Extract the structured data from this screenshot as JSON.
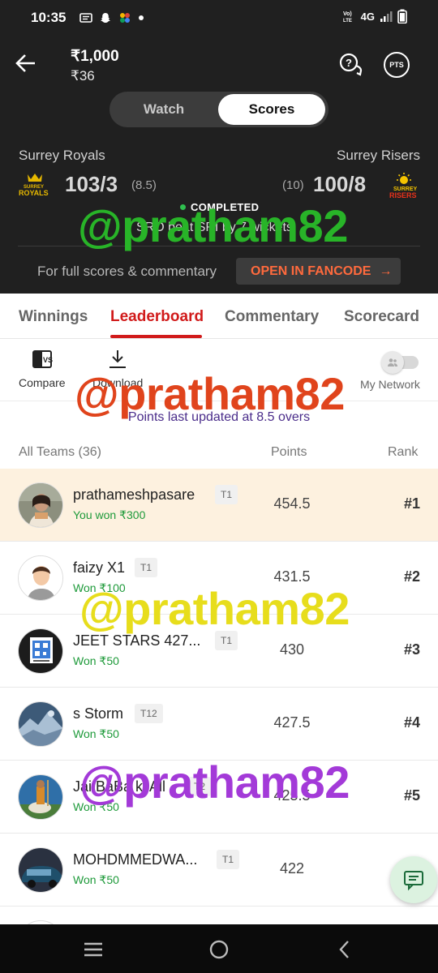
{
  "status_bar": {
    "time": "10:35",
    "network": "4G",
    "icons": [
      "message-icon",
      "snapchat-icon",
      "pinwheel-icon",
      "dot-icon",
      "volte-icon",
      "signal-icon",
      "battery-icon"
    ]
  },
  "header": {
    "amount_primary": "₹1,000",
    "amount_secondary": "₹36",
    "pts_label": "PTS"
  },
  "toggle": {
    "watch": "Watch",
    "scores": "Scores",
    "active": "Scores"
  },
  "match": {
    "team_left": "Surrey Royals",
    "team_right": "Surrey Risers",
    "logo_left_text": [
      "SURREY",
      "ROYALS"
    ],
    "logo_right_text": [
      "SURREY",
      "RISERS"
    ],
    "score_left": "103/3",
    "overs_left": "(8.5)",
    "overs_right": "(10)",
    "score_right": "100/8",
    "status": "COMPLETED",
    "result": "SRO beat SRI by 7 wickets",
    "full_scores_text": "For full scores & commentary",
    "fancode_button": "OPEN IN FANCODE",
    "fancode_arrow": "→"
  },
  "tabs": [
    {
      "label": "Winnings"
    },
    {
      "label": "Leaderboard"
    },
    {
      "label": "Commentary"
    },
    {
      "label": "Scorecard"
    }
  ],
  "active_tab": "Leaderboard",
  "tools": {
    "compare": "Compare",
    "download": "Download",
    "my_network": "My Network"
  },
  "updated_text": "Points last updated at 8.5 overs",
  "list_header": {
    "teams": "All Teams (36)",
    "points": "Points",
    "rank": "Rank"
  },
  "leaderboard": [
    {
      "name": "prathameshpasare",
      "team": "T1",
      "won": "You won ₹300",
      "points": "454.5",
      "rank": "#1"
    },
    {
      "name": "faizy X1",
      "team": "T1",
      "won": "Won ₹100",
      "points": "431.5",
      "rank": "#2"
    },
    {
      "name": "JEET STARS 427...",
      "team": "T1",
      "won": "Won ₹50",
      "points": "430",
      "rank": "#3"
    },
    {
      "name": "s Storm",
      "team": "T12",
      "won": "Won ₹50",
      "points": "427.5",
      "rank": "#4"
    },
    {
      "name": "Jai BaBa ki All",
      "team": "T2",
      "won": "Won ₹50",
      "points": "425.5",
      "rank": "#5"
    },
    {
      "name": "MOHDMMEDWA...",
      "team": "T1",
      "won": "Won ₹50",
      "points": "422",
      "rank": ""
    }
  ],
  "watermark": "@pratham82",
  "colors": {
    "accent": "#d11b1b",
    "fancode": "#ff6a3d",
    "won_green": "#1e9a3a",
    "highlight_row": "#fdf1df",
    "header_bg": "#202020"
  }
}
